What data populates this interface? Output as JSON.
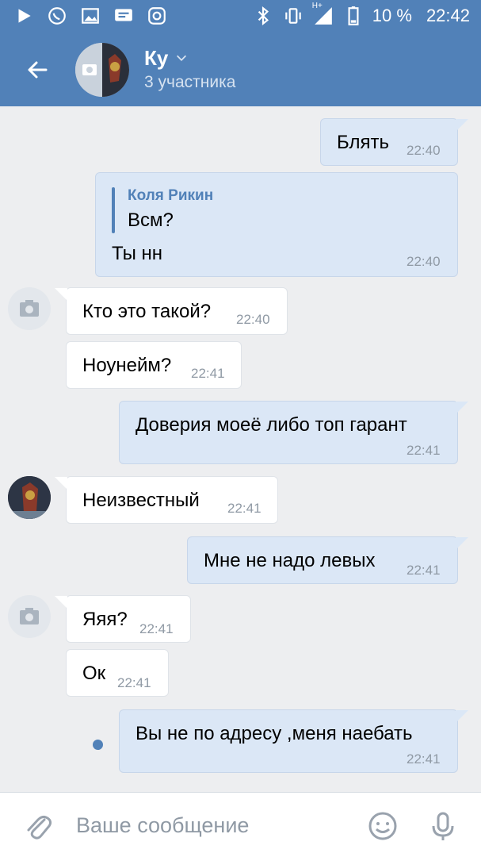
{
  "status_bar": {
    "battery": "10 %",
    "time": "22:42",
    "network": "H+"
  },
  "header": {
    "title": "Ку",
    "subtitle": "3 участника"
  },
  "messages": [
    {
      "dir": "out",
      "text": "Блять",
      "time": "22:40"
    },
    {
      "dir": "out",
      "reply_name": "Коля Рикин",
      "reply_text": "Всм?",
      "text": "Ты нн",
      "time": "22:40"
    },
    {
      "dir": "in",
      "text": "Кто это такой?",
      "time": "22:40"
    },
    {
      "dir": "in",
      "text": "Ноунейм?",
      "time": "22:41"
    },
    {
      "dir": "out",
      "text": "Доверия моеё либо топ гарант",
      "time": "22:41"
    },
    {
      "dir": "in",
      "text": "Неизвестный",
      "time": "22:41"
    },
    {
      "dir": "out",
      "text": "Мне не надо левых",
      "time": "22:41"
    },
    {
      "dir": "in",
      "text": "Яяя?",
      "time": "22:41"
    },
    {
      "dir": "in",
      "text": "Ок",
      "time": "22:41"
    },
    {
      "dir": "out",
      "text": "Вы не по адресу ,меня наебать",
      "time": "22:41"
    }
  ],
  "composer": {
    "placeholder": "Ваше сообщение"
  },
  "colors": {
    "accent": "#5181b8",
    "outgoing_bubble": "#dbe7f6",
    "incoming_bubble": "#ffffff",
    "background": "#edeef0"
  }
}
